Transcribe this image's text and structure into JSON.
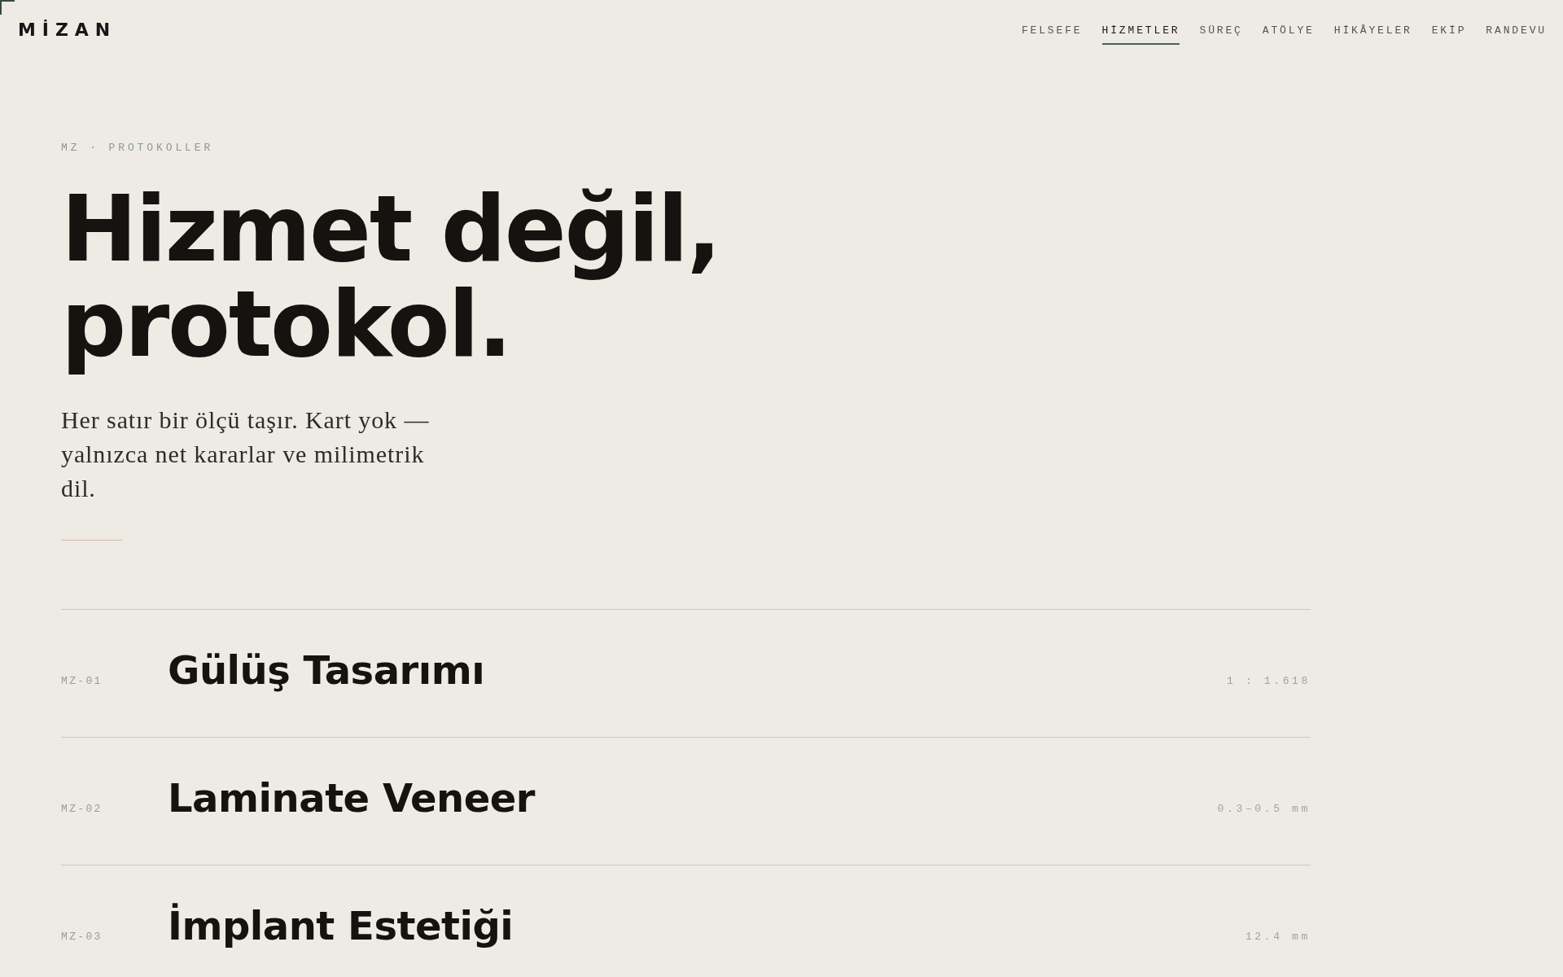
{
  "logo": {
    "text": "MİZAN"
  },
  "nav": [
    {
      "label": "FELSEFE",
      "selected": false
    },
    {
      "label": "HİZMETLER",
      "selected": true
    },
    {
      "label": "SÜREÇ",
      "selected": false
    },
    {
      "label": "ATÖLYE",
      "selected": false
    },
    {
      "label": "HİKÂYELER",
      "selected": false
    },
    {
      "label": "EKİP",
      "selected": false
    },
    {
      "label": "RANDEVU",
      "selected": false
    }
  ],
  "hero": {
    "eyebrow": "MZ · PROTOKOLLER",
    "title": "Hizmet değil, protokol.",
    "lede": "Her satır bir ölçü taşır. Kart yok — yalnızca net kararlar ve milimetrik dil."
  },
  "protocols": [
    {
      "code": "MZ-01",
      "title": "Gülüş Tasarımı",
      "measure": "1 : 1.618"
    },
    {
      "code": "MZ-02",
      "title": "Laminate Veneer",
      "measure": "0.3–0.5 mm"
    },
    {
      "code": "MZ-03",
      "title": "İmplant Estetiği",
      "measure": "12.4 mm"
    }
  ]
}
